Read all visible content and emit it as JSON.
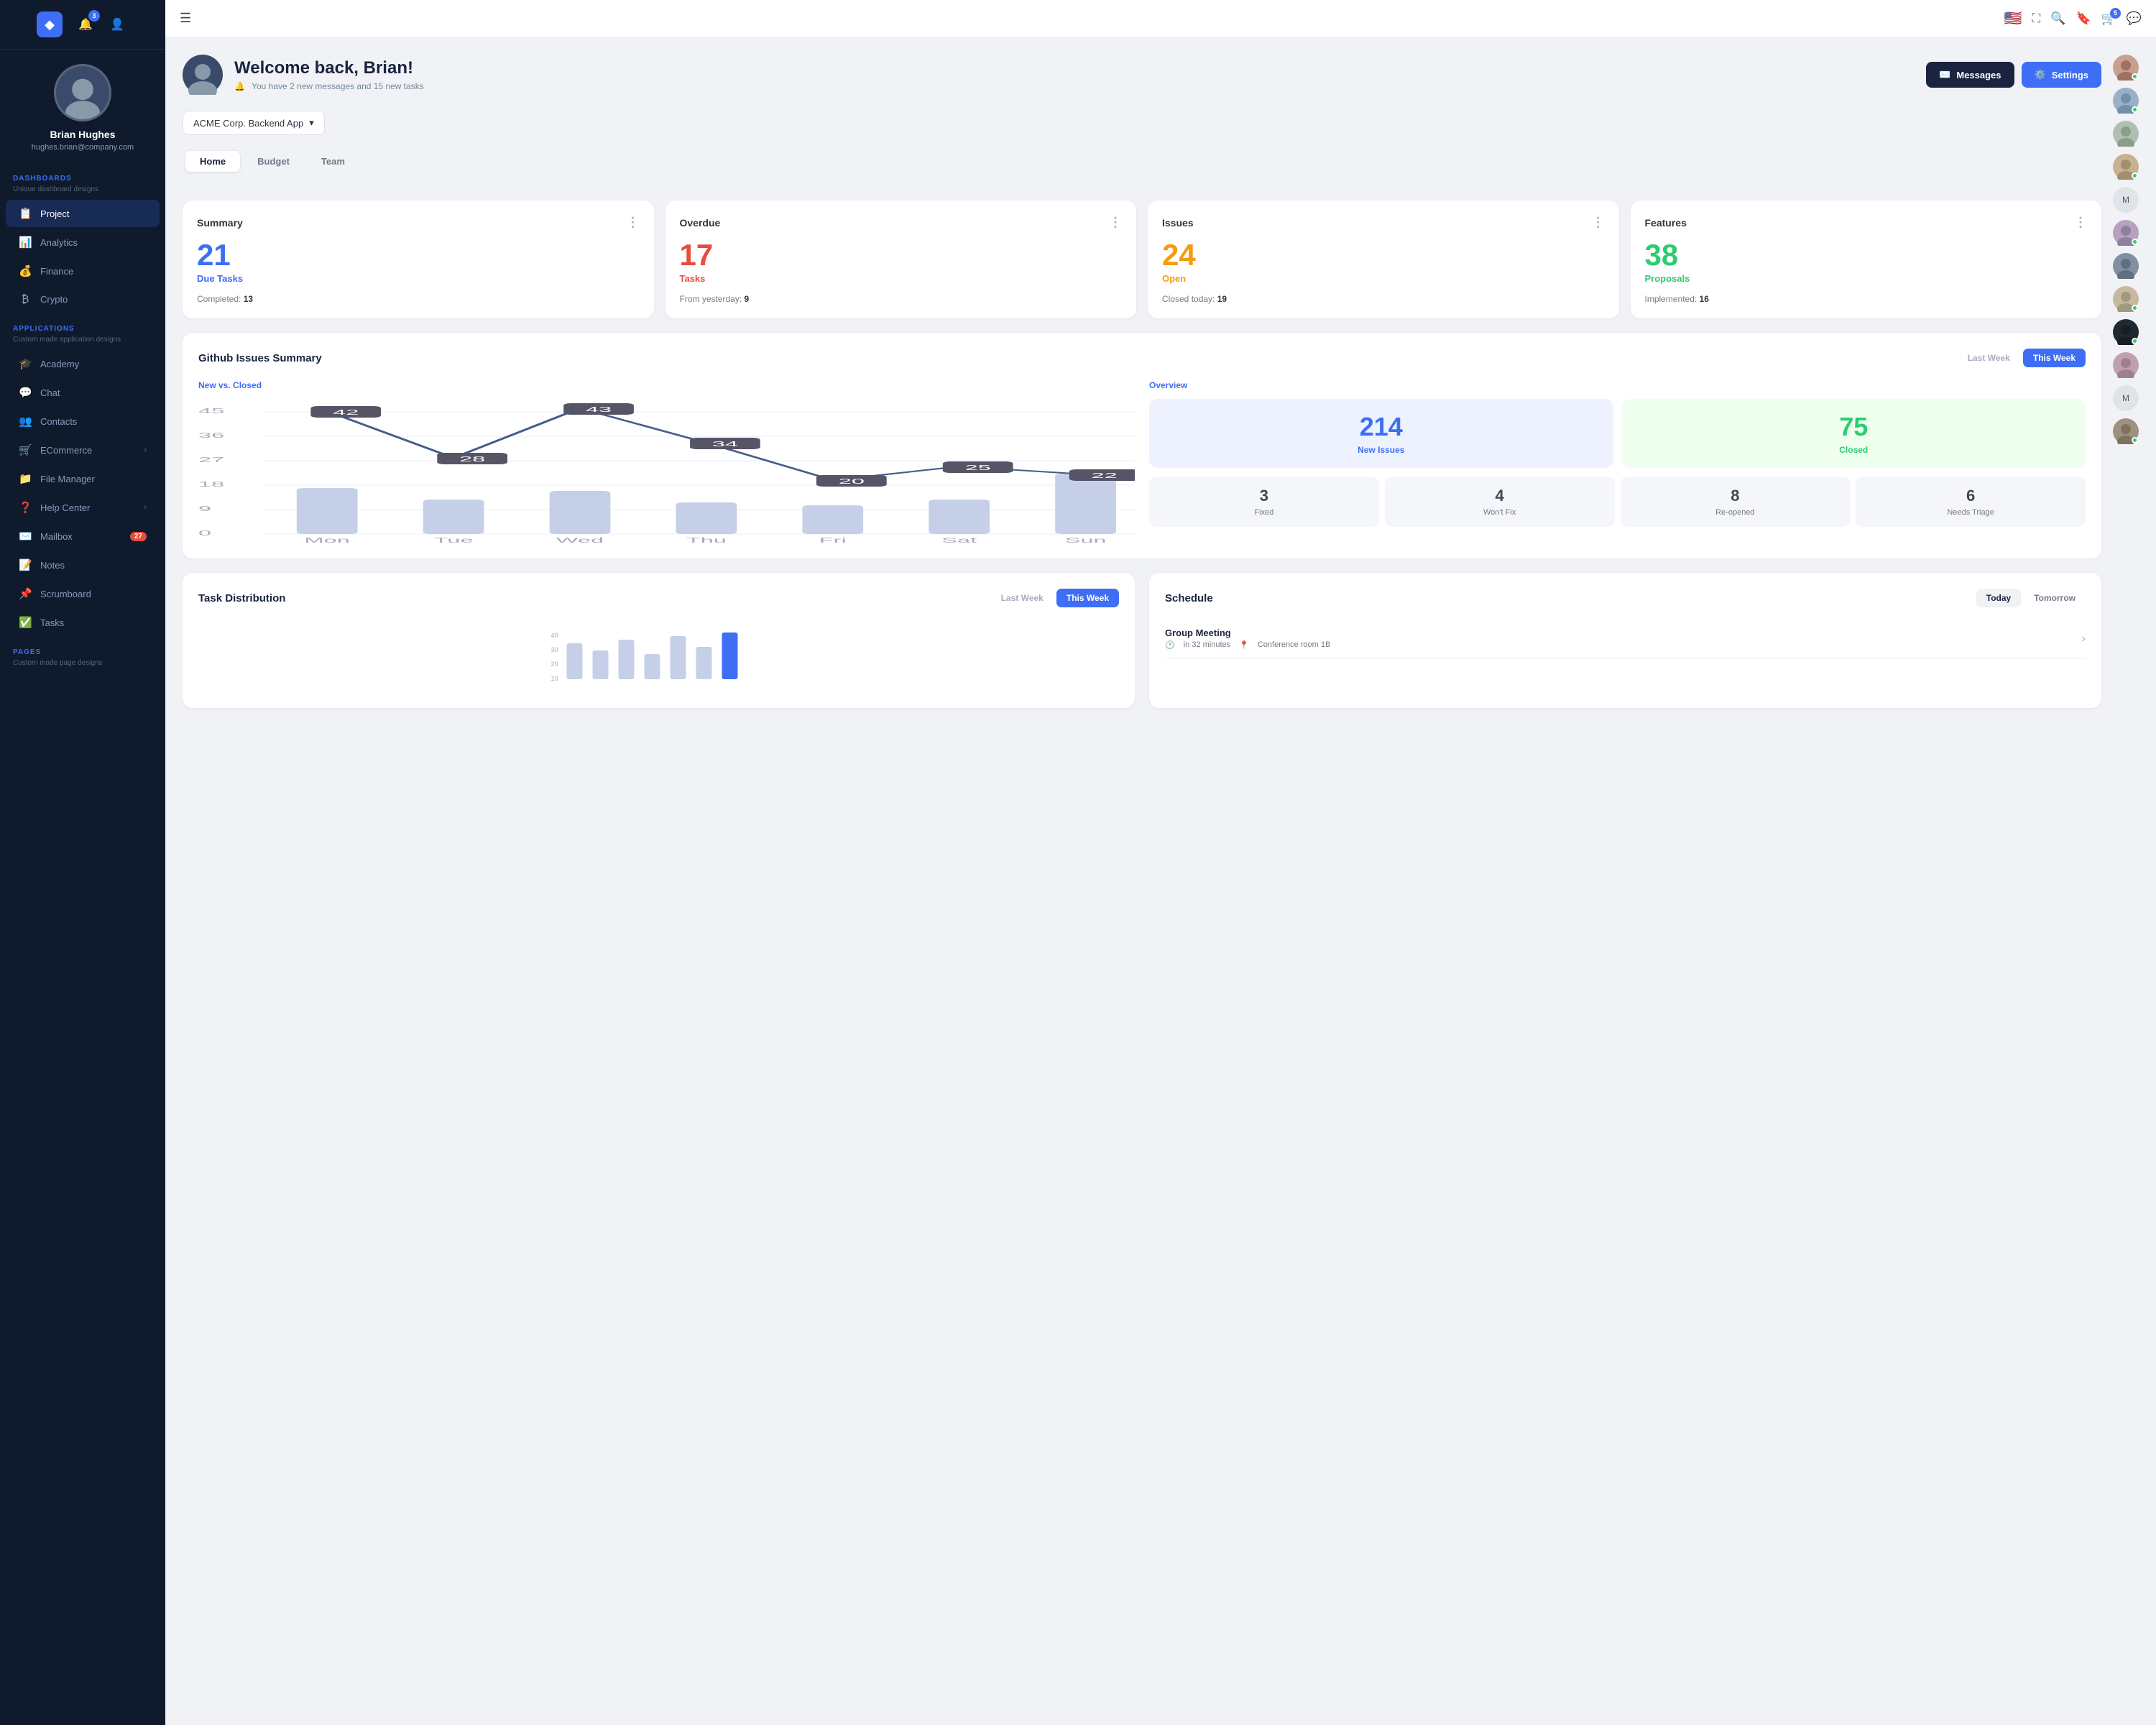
{
  "sidebar": {
    "logo": "◆",
    "notification_badge": "3",
    "user": {
      "name": "Brian Hughes",
      "email": "hughes.brian@company.com"
    },
    "dashboards_label": "DASHBOARDS",
    "dashboards_sub": "Unique dashboard designs",
    "nav_items": [
      {
        "icon": "📋",
        "label": "Project",
        "active": true
      },
      {
        "icon": "📊",
        "label": "Analytics"
      },
      {
        "icon": "💰",
        "label": "Finance"
      },
      {
        "icon": "₿",
        "label": "Crypto"
      }
    ],
    "applications_label": "APPLICATIONS",
    "applications_sub": "Custom made application designs",
    "app_items": [
      {
        "icon": "🎓",
        "label": "Academy"
      },
      {
        "icon": "💬",
        "label": "Chat"
      },
      {
        "icon": "👥",
        "label": "Contacts"
      },
      {
        "icon": "🛒",
        "label": "ECommerce",
        "arrow": true
      },
      {
        "icon": "📁",
        "label": "File Manager"
      },
      {
        "icon": "❓",
        "label": "Help Center",
        "arrow": true
      },
      {
        "icon": "✉️",
        "label": "Mailbox",
        "badge": "27"
      },
      {
        "icon": "📝",
        "label": "Notes"
      },
      {
        "icon": "📌",
        "label": "Scrumboard"
      },
      {
        "icon": "✅",
        "label": "Tasks"
      }
    ],
    "pages_label": "PAGES",
    "pages_sub": "Custom made page designs"
  },
  "topbar": {
    "notification_badge": "5"
  },
  "welcome": {
    "title": "Welcome back, Brian!",
    "subtitle": "You have 2 new messages and 15 new tasks",
    "messages_btn": "Messages",
    "settings_btn": "Settings"
  },
  "project_selector": "ACME Corp. Backend App",
  "tabs": [
    "Home",
    "Budget",
    "Team"
  ],
  "active_tab": "Home",
  "stat_cards": [
    {
      "title": "Summary",
      "number": "21",
      "label": "Due Tasks",
      "color": "color-blue",
      "sub_label": "Completed:",
      "sub_value": "13"
    },
    {
      "title": "Overdue",
      "number": "17",
      "label": "Tasks",
      "color": "color-red",
      "sub_label": "From yesterday:",
      "sub_value": "9"
    },
    {
      "title": "Issues",
      "number": "24",
      "label": "Open",
      "color": "color-orange",
      "sub_label": "Closed today:",
      "sub_value": "19"
    },
    {
      "title": "Features",
      "number": "38",
      "label": "Proposals",
      "color": "color-green",
      "sub_label": "Implemented:",
      "sub_value": "16"
    }
  ],
  "github_section": {
    "title": "Github Issues Summary",
    "last_week": "Last Week",
    "this_week": "This Week",
    "active_period": "This Week",
    "chart_subtitle": "New vs. Closed",
    "overview_title": "Overview",
    "chart_data": {
      "days": [
        "Mon",
        "Tue",
        "Wed",
        "Thu",
        "Fri",
        "Sat",
        "Sun"
      ],
      "line_values": [
        42,
        28,
        43,
        34,
        20,
        25,
        22
      ],
      "bar_values": [
        30,
        22,
        28,
        20,
        18,
        22,
        38
      ]
    },
    "new_issues": "214",
    "new_issues_label": "New Issues",
    "closed": "75",
    "closed_label": "Closed",
    "mini_stats": [
      {
        "num": "3",
        "label": "Fixed"
      },
      {
        "num": "4",
        "label": "Won't Fix"
      },
      {
        "num": "8",
        "label": "Re-opened"
      },
      {
        "num": "6",
        "label": "Needs Triage"
      }
    ]
  },
  "task_distribution": {
    "title": "Task Distribution",
    "last_week": "Last Week",
    "this_week": "This Week",
    "active_period": "This Week",
    "y_max": 40
  },
  "schedule": {
    "title": "Schedule",
    "today": "Today",
    "tomorrow": "Tomorrow",
    "active": "Today",
    "items": [
      {
        "name": "Group Meeting",
        "time": "in 32 minutes",
        "location": "Conference room 1B"
      }
    ]
  },
  "right_avatars": [
    {
      "initial": "👤",
      "online": true
    },
    {
      "initial": "👤",
      "online": true
    },
    {
      "initial": "👤",
      "online": false
    },
    {
      "initial": "👤",
      "online": true
    },
    {
      "initial": "M",
      "text": true
    },
    {
      "initial": "👤",
      "online": true
    },
    {
      "initial": "👤",
      "online": false
    },
    {
      "initial": "👤",
      "online": true
    },
    {
      "initial": "👤",
      "online": true
    },
    {
      "initial": "👤",
      "online": false
    },
    {
      "initial": "M",
      "text": true
    },
    {
      "initial": "👤",
      "online": true
    }
  ]
}
